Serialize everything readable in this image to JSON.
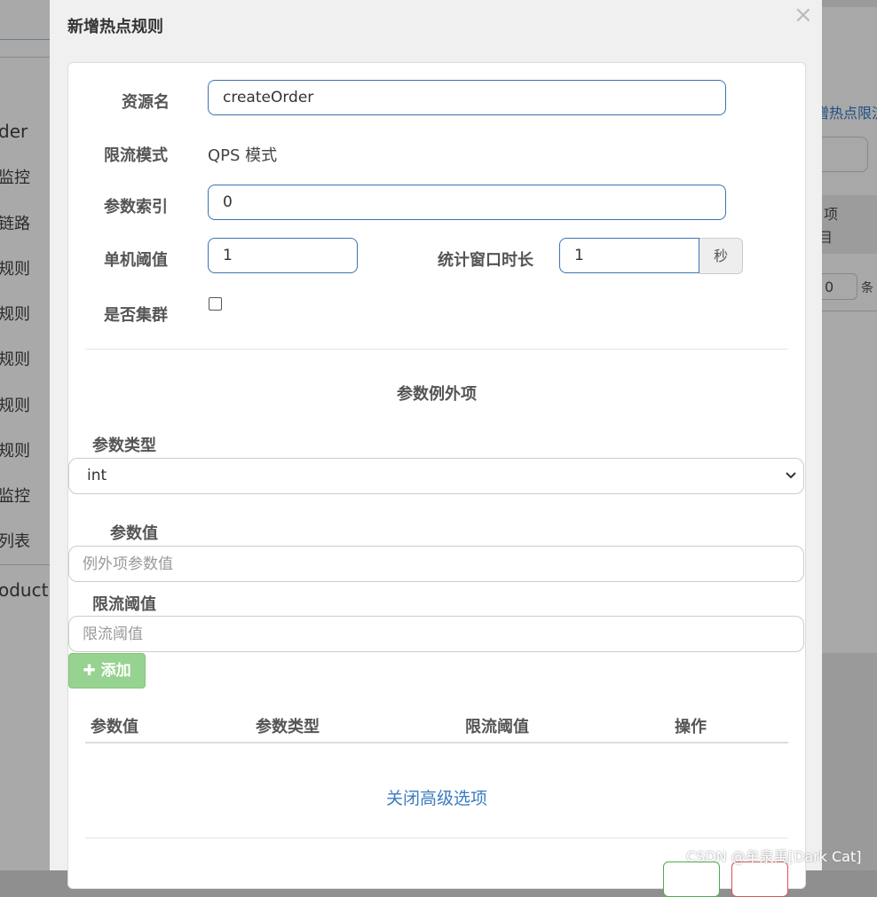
{
  "background_left": {
    "app_name": "der",
    "items": [
      "监控",
      "链路",
      "规则",
      "规则",
      "规则",
      "规则",
      "规则",
      "监控",
      "列表"
    ],
    "app_name_2": "oduct"
  },
  "background_right": {
    "link": "增热点限流",
    "col1": "项",
    "col2": "目",
    "page_input": "0",
    "page_unit": "条"
  },
  "modal": {
    "title": "新增热点规则",
    "close": "×"
  },
  "form": {
    "resource_label": "资源名",
    "resource_value": "createOrder",
    "mode_label": "限流模式",
    "mode_value": "QPS 模式",
    "param_index_label": "参数索引",
    "param_index_value": "0",
    "threshold_label": "单机阈值",
    "threshold_value": "1",
    "window_label": "统计窗口时长",
    "window_value": "1",
    "window_unit": "秒",
    "cluster_label": "是否集群",
    "cluster_checked": false
  },
  "exceptions": {
    "title": "参数例外项",
    "type_label": "参数类型",
    "type_selected": "int",
    "value_label": "参数值",
    "value_placeholder": "例外项参数值",
    "limit_label": "限流阈值",
    "limit_placeholder": "限流阈值",
    "add_button": "添加",
    "table_headers": [
      "参数值",
      "参数类型",
      "限流阈值",
      "操作"
    ]
  },
  "advanced_toggle": "关闭高级选项",
  "watermark": "CSDN @牟泉禹[Dark Cat]",
  "colors": {
    "primary_border": "#3b73b0",
    "link": "#3a7bbf",
    "add_button_bg": "#96d290",
    "modal_bg": "#f0f0f0"
  }
}
